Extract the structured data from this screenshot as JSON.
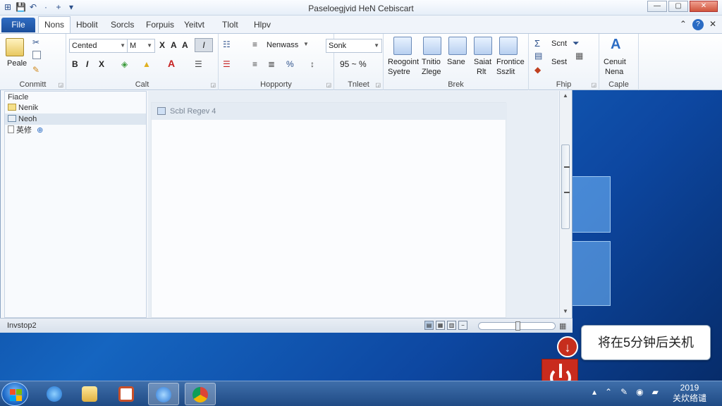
{
  "window": {
    "title": "Paseloegjvid HeN Cebiscart",
    "controls": [
      "—",
      "▢",
      "✕"
    ]
  },
  "quick_access": [
    "⊞",
    "💾",
    "↶",
    "·",
    "+",
    "▾"
  ],
  "tabs": {
    "file": "File",
    "items": [
      "Nons",
      "Hbolit",
      "Sorcls",
      "Forpuis",
      "Yeitvt",
      "Tlolt",
      "Hlpv"
    ],
    "active": "Nons",
    "right": [
      "⌃",
      "?",
      "✕"
    ]
  },
  "ribbon": {
    "clipboard": {
      "label": "Conmitt",
      "paste": "Peale"
    },
    "font": {
      "label": "Calt",
      "font_name": "Cented",
      "font_size": "M",
      "buttons": [
        "X",
        "A",
        "A"
      ],
      "format": [
        "B",
        "I",
        "X"
      ]
    },
    "paragraph": {
      "label": "Hopporty",
      "style": "Nenwass"
    },
    "number": {
      "label": "Tnleet",
      "format": "Sonk",
      "pct": "95 ~ %"
    },
    "styles": {
      "label": "Brek",
      "buttons": [
        {
          "l1": "Reogoint",
          "l2": "Syetre"
        },
        {
          "l1": "Tnitio",
          "l2": "Zlege"
        },
        {
          "l1": "Sane",
          "l2": ""
        },
        {
          "l1": "Saiat",
          "l2": "Rlt"
        },
        {
          "l1": "Frontice",
          "l2": "Sszlit"
        }
      ]
    },
    "editing": {
      "label": "Fhip",
      "row1": "Scnt",
      "row2": "Sest"
    },
    "caple": {
      "label": "Caple",
      "l1": "Cenuit",
      "l2": "Nena"
    }
  },
  "nav_pane": {
    "header": "Fiacle",
    "items": [
      "Nenik",
      "Neoh",
      "英修"
    ],
    "selected": "Neoh"
  },
  "document": {
    "page_header": "Scbl Regev 4"
  },
  "status_bar": {
    "text": "Invstop2"
  },
  "notification": {
    "text": "将在5分钟后关机"
  },
  "taskbar": {
    "clock_line1": "2019",
    "clock_line2": "关炊络谴"
  },
  "colors": {
    "accent": "#1c4f9c",
    "power_red": "#c92b1d",
    "taskbar": "#2f5c98"
  }
}
